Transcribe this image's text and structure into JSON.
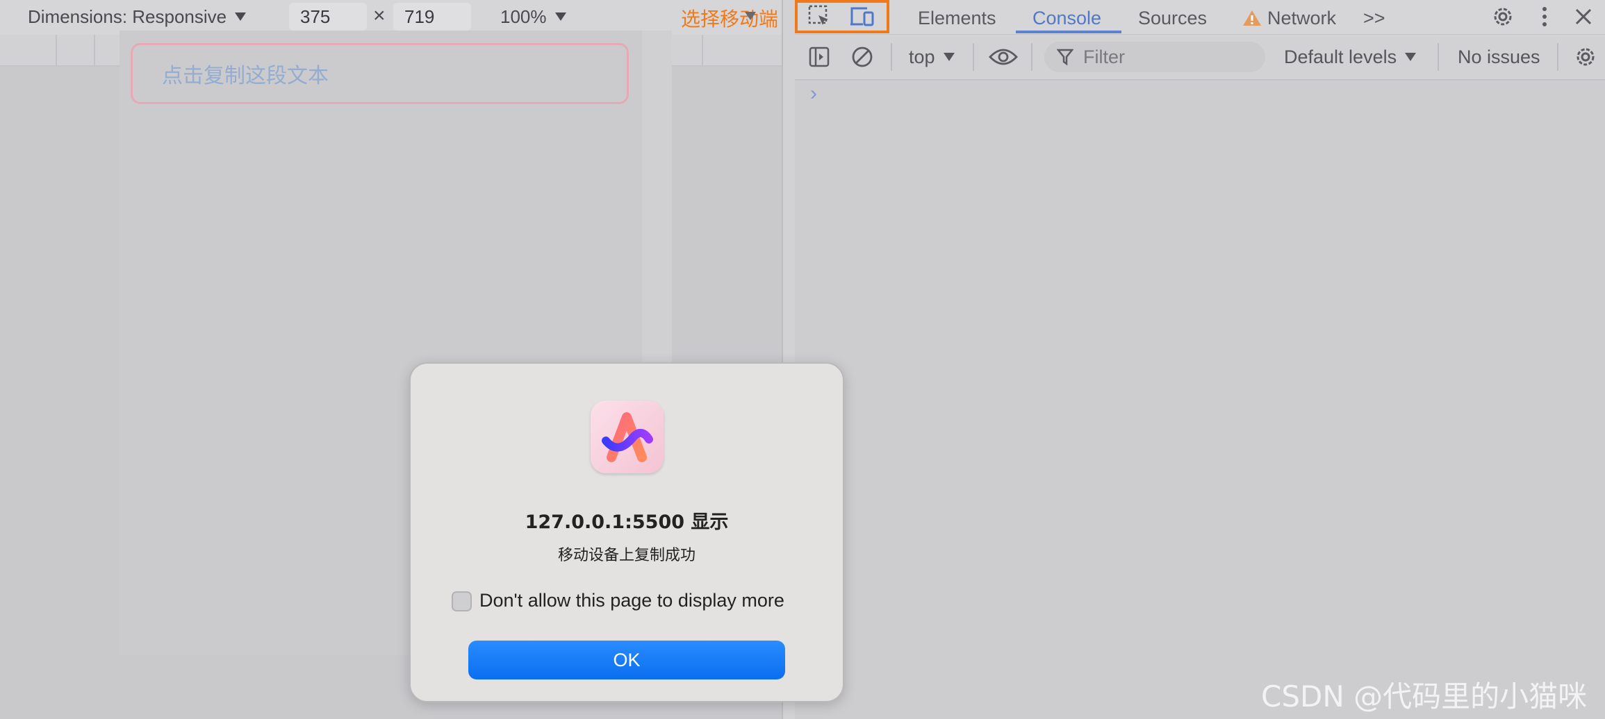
{
  "device_toolbar": {
    "dimensions_label": "Dimensions: Responsive",
    "width_value": "375",
    "height_value": "719",
    "times_sign": "×",
    "zoom_value": "100%",
    "annotation_text": "选择移动端"
  },
  "page": {
    "copy_text": "点击复制这段文本"
  },
  "devtools": {
    "tabs": [
      {
        "label": "Elements"
      },
      {
        "label": "Console"
      },
      {
        "label": "Sources"
      },
      {
        "label": "Network"
      }
    ],
    "more_tabs_label": ">>",
    "console_toolbar": {
      "context": "top",
      "filter_placeholder": "Filter",
      "levels": "Default levels",
      "issues": "No issues"
    },
    "prompt": "›"
  },
  "dialog": {
    "title": "127.0.0.1:5500 显示",
    "message": "移动设备上复制成功",
    "checkbox_label": "Don't allow this page to display more",
    "ok_label": "OK"
  },
  "watermark": "CSDN @代码里的小猫咪",
  "colors": {
    "accent": "#4f79c8",
    "annotation": "#f07a1a",
    "ok_button": "#0a6ef0"
  }
}
